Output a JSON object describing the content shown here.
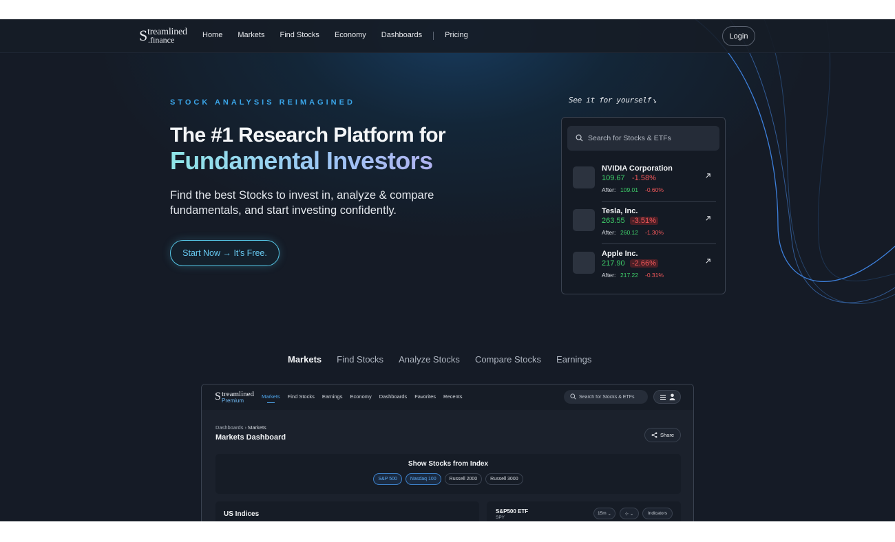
{
  "nav": {
    "logo_line1": "treamlined",
    "logo_line2": ".finance",
    "logo_initial": "S",
    "links": [
      "Home",
      "Markets",
      "Find Stocks",
      "Economy",
      "Dashboards"
    ],
    "pricing": "Pricing",
    "login": "Login"
  },
  "hero": {
    "eyebrow": "STOCK ANALYSIS REIMAGINED",
    "headline_line1": "The #1 Research Platform for",
    "headline_line2": "Fundamental Investors",
    "subhead": "Find the best Stocks to invest in, analyze & compare fundamentals, and start investing confidently.",
    "cta": "Start Now → It’s Free."
  },
  "demo": {
    "note": "See it for yourself",
    "search_placeholder": "Search for Stocks & ETFs",
    "after_label": "After:",
    "stocks": [
      {
        "name": "NVIDIA Corporation",
        "price": "109.67",
        "change": "-1.58%",
        "after_price": "109.01",
        "after_change": "-0.60%"
      },
      {
        "name": "Tesla, Inc.",
        "price": "263.55",
        "change": "-3.51%",
        "after_price": "260.12",
        "after_change": "-1.30%"
      },
      {
        "name": "Apple Inc.",
        "price": "217.90",
        "change": "-2.66%",
        "after_price": "217.22",
        "after_change": "-0.31%"
      }
    ]
  },
  "feature_tabs": [
    "Markets",
    "Find Stocks",
    "Analyze Stocks",
    "Compare Stocks",
    "Earnings"
  ],
  "preview": {
    "logo_line1": "treamlined",
    "logo_initial": "S",
    "logo_line2": "Premium",
    "links": [
      "Markets",
      "Find Stocks",
      "Earnings",
      "Economy",
      "Dashboards",
      "Favorites",
      "Recents"
    ],
    "search_placeholder": "Search for Stocks & ETFs",
    "breadcrumb_root": "Dashboards",
    "breadcrumb_sep": "›",
    "breadcrumb_current": "Markets",
    "title": "Markets Dashboard",
    "share": "Share",
    "index_title": "Show Stocks from Index",
    "index_pills": [
      "S&P 500",
      "Nasdaq 100",
      "Russell 2000",
      "Russell 3000"
    ],
    "us_indices": "US Indices",
    "etf_name": "S&P500 ETF",
    "etf_ticker": "SPY",
    "interval": "15m",
    "indicators": "Indicators"
  },
  "colors": {
    "accent_blue": "#3aa5e8",
    "positive": "#3ecf6a",
    "negative": "#f2585a",
    "background": "#151b26"
  }
}
